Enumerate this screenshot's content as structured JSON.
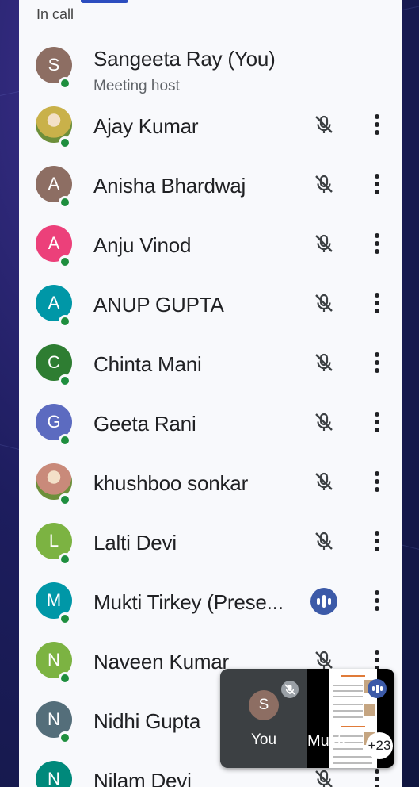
{
  "header": {
    "section_label": "In call"
  },
  "participants": [
    {
      "name": "Sangeeta Ray (You)",
      "subtitle": "Meeting host",
      "initial": "S",
      "avatar_color": "#8d6e63",
      "avatar_type": "letter",
      "status": "host"
    },
    {
      "name": "Ajay Kumar",
      "initial": "",
      "avatar_color": "#c9b14a",
      "avatar_type": "photo",
      "status": "muted"
    },
    {
      "name": "Anisha Bhardwaj",
      "initial": "A",
      "avatar_color": "#8d6e63",
      "avatar_type": "letter",
      "status": "muted"
    },
    {
      "name": "Anju Vinod",
      "initial": "A",
      "avatar_color": "#ec407a",
      "avatar_type": "letter",
      "status": "muted"
    },
    {
      "name": "ANUP GUPTA",
      "initial": "A",
      "avatar_color": "#0097a7",
      "avatar_type": "letter",
      "status": "muted"
    },
    {
      "name": "Chinta Mani",
      "initial": "C",
      "avatar_color": "#2e7d32",
      "avatar_type": "letter",
      "status": "muted"
    },
    {
      "name": "Geeta Rani",
      "initial": "G",
      "avatar_color": "#5c6bc0",
      "avatar_type": "letter",
      "status": "muted"
    },
    {
      "name": "khushboo sonkar",
      "initial": "",
      "avatar_color": "#c98a7a",
      "avatar_type": "photo",
      "status": "muted"
    },
    {
      "name": "Lalti Devi",
      "initial": "L",
      "avatar_color": "#7cb342",
      "avatar_type": "letter",
      "status": "muted"
    },
    {
      "name": "Mukti Tirkey (Prese...",
      "initial": "M",
      "avatar_color": "#0097a7",
      "avatar_type": "letter",
      "status": "speaking"
    },
    {
      "name": "Naveen Kumar",
      "initial": "N",
      "avatar_color": "#7cb342",
      "avatar_type": "letter",
      "status": "muted"
    },
    {
      "name": "Nidhi Gupta",
      "initial": "N",
      "avatar_color": "#546e7a",
      "avatar_type": "letter",
      "status": "hidden"
    },
    {
      "name": "Nilam Devi",
      "initial": "N",
      "avatar_color": "#00897b",
      "avatar_type": "letter",
      "status": "muted"
    }
  ],
  "pip": {
    "self_initial": "S",
    "self_label": "You",
    "other_name": "Mukti",
    "extra_count": "+23"
  },
  "colors": {
    "online": "#1e8e3e",
    "speaking": "#3c5aa8",
    "tab_indicator": "#2c4dbf"
  }
}
